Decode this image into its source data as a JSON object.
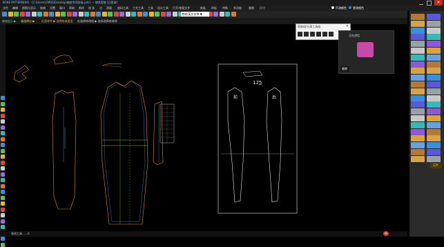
{
  "window": {
    "title": "BOKE PATTERN(64) - [C:\\Users\\CMOS\\Desktop\\旗袍专用样板.pds] --- 博克智能 [已登录]"
  },
  "menu": [
    "文件",
    "编辑",
    "视图与显示",
    "放缩",
    "设置",
    "窗口",
    "帮助",
    "纸样",
    "线 条",
    "点",
    "测量",
    "放码工具",
    "工艺工具",
    "工具",
    "设计工具",
    "打开/恢复文件",
    "推板",
    "样板",
    "特殊",
    "多功能",
    "服装",
    "尺寸"
  ],
  "options": {
    "left_label": "缩放显示 ▶",
    "mode_label": "请选择点 ▶",
    "hint": "在菜单中 ▶ 选择修改类型",
    "hint2": "在选择修改线 ▶ 连续选择修改线"
  },
  "font_select": "常规/英文名称 ▼",
  "top_right": {
    "radio_a": "不改颜色",
    "radio_b": "更改颜色"
  },
  "popup": {
    "title": "智能组/分离工具组"
  },
  "video": {
    "label": "正在讲话",
    "badge": "截图"
  },
  "pattern_label": "175",
  "front_label": "前",
  "back_label": "后",
  "status": {
    "left": "直线工具……",
    "count": "0"
  },
  "ime": "中",
  "grade_btn": "CH"
}
